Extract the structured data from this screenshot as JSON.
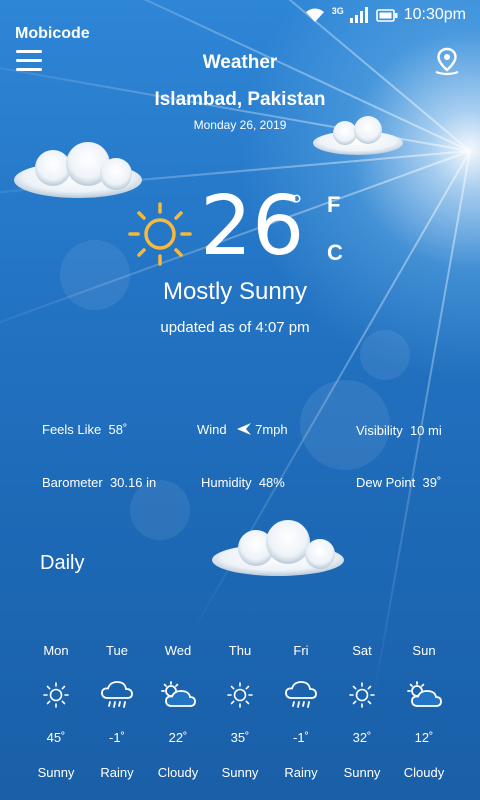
{
  "status_bar": {
    "network": "3G",
    "time": "10:30pm"
  },
  "app": {
    "brand": "Mobicode",
    "title": "Weather"
  },
  "location": {
    "city": "Islambad, Pakistan",
    "date": "Monday 26, 2019"
  },
  "current": {
    "temperature": "26",
    "degree_symbol": "°",
    "unit_f": "F",
    "unit_c": "C",
    "condition": "Mostly Sunny",
    "updated": "updated as of 4:07 pm"
  },
  "details": {
    "feels_like_label": "Feels Like",
    "feels_like_value": "58˚",
    "wind_label": "Wind",
    "wind_value": "7mph",
    "visibility_label": "Visibility",
    "visibility_value": "10 mi",
    "barometer_label": "Barometer",
    "barometer_value": "30.16 in",
    "humidity_label": "Humidity",
    "humidity_value": "48%",
    "dew_point_label": "Dew Point",
    "dew_point_value": "39˚"
  },
  "daily": {
    "title": "Daily",
    "days": [
      {
        "name": "Mon",
        "icon": "sun-icon",
        "temp": "45˚",
        "condition": "Sunny"
      },
      {
        "name": "Tue",
        "icon": "rain-icon",
        "temp": "-1˚",
        "condition": "Rainy"
      },
      {
        "name": "Wed",
        "icon": "cloudy-icon",
        "temp": "22˚",
        "condition": "Cloudy"
      },
      {
        "name": "Thu",
        "icon": "sun-icon",
        "temp": "35˚",
        "condition": "Sunny"
      },
      {
        "name": "Fri",
        "icon": "rain-icon",
        "temp": "-1˚",
        "condition": "Rainy"
      },
      {
        "name": "Sat",
        "icon": "sun-icon",
        "temp": "32˚",
        "condition": "Sunny"
      },
      {
        "name": "Sun",
        "icon": "cloudy-icon",
        "temp": "12˚",
        "condition": "Cloudy"
      }
    ]
  },
  "colors": {
    "sun_yellow": "#f6b93b",
    "sky_blue": "#2374c4"
  }
}
